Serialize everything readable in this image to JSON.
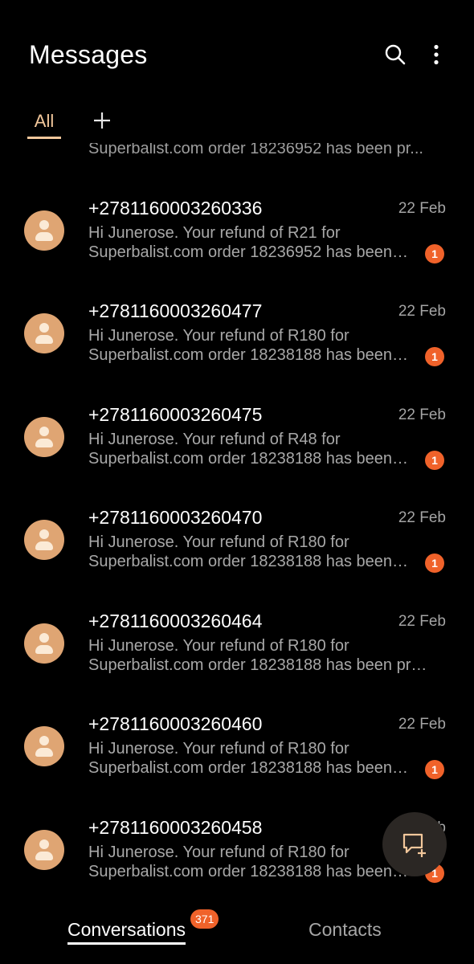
{
  "header": {
    "title": "Messages",
    "search_icon": "search-icon",
    "more_icon": "more-vertical-icon"
  },
  "tabs": {
    "all_label": "All",
    "add_icon": "plus-icon"
  },
  "partial_snippet": "Superbalist.com order 18236952 has been pr...",
  "conversations": [
    {
      "sender": "+2781160003260336",
      "date": "22 Feb",
      "line1": "Hi Junerose. Your refund of R21 for",
      "line2": "Superbalist.com order 18236952 has been…",
      "unread": "1"
    },
    {
      "sender": "+2781160003260477",
      "date": "22 Feb",
      "line1": "Hi Junerose. Your refund of R180 for",
      "line2": "Superbalist.com order 18238188 has been…",
      "unread": "1"
    },
    {
      "sender": "+2781160003260475",
      "date": "22 Feb",
      "line1": "Hi Junerose. Your refund of R48 for",
      "line2": "Superbalist.com order 18238188 has been…",
      "unread": "1"
    },
    {
      "sender": "+2781160003260470",
      "date": "22 Feb",
      "line1": "Hi Junerose. Your refund of R180 for",
      "line2": "Superbalist.com order 18238188 has been…",
      "unread": "1"
    },
    {
      "sender": "+2781160003260464",
      "date": "22 Feb",
      "line1": "Hi Junerose. Your refund of R180 for",
      "line2": "Superbalist.com order 18238188 has been pr…",
      "unread": null
    },
    {
      "sender": "+2781160003260460",
      "date": "22 Feb",
      "line1": "Hi Junerose. Your refund of R180 for",
      "line2": "Superbalist.com order 18238188 has been…",
      "unread": "1"
    },
    {
      "sender": "+2781160003260458",
      "date": "22 Feb",
      "line1": "Hi Junerose. Your refund of R180 for",
      "line2": "Superbalist.com order 18238188 has been…",
      "unread": "1"
    }
  ],
  "fab": {
    "icon": "new-message-icon"
  },
  "bottom_nav": {
    "conversations_label": "Conversations",
    "conversations_badge": "371",
    "contacts_label": "Contacts"
  },
  "colors": {
    "background": "#000000",
    "accent": "#f2c79b",
    "avatar": "#dfa573",
    "unread_badge": "#f0622a"
  }
}
